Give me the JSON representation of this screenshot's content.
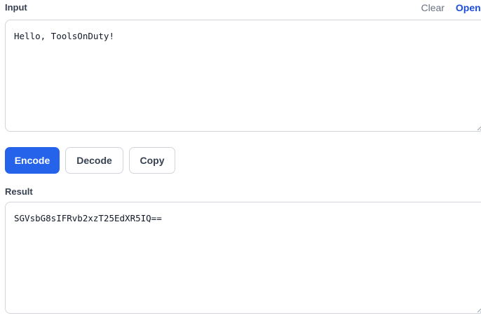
{
  "input_section": {
    "label": "Input",
    "clear_label": "Clear",
    "open_file_label": "Open fil",
    "value": "Hello, ToolsOnDuty!"
  },
  "actions": {
    "encode_label": "Encode",
    "decode_label": "Decode",
    "copy_label": "Copy"
  },
  "result_section": {
    "label": "Result",
    "value": "SGVsbG8sIFRvb2xzT25EdXR5IQ=="
  },
  "colors": {
    "primary": "#2563eb",
    "link": "#1d4ed8",
    "border": "#d1d5db"
  }
}
